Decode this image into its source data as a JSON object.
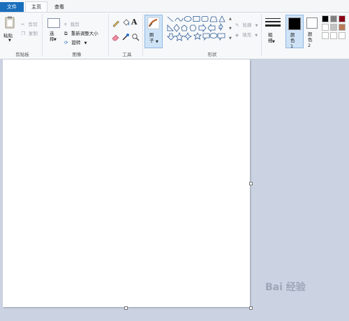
{
  "tabs": {
    "file": "文件",
    "home": "主页",
    "view": "查看"
  },
  "clipboard": {
    "paste": "粘贴",
    "cut": "剪切",
    "copy": "复制",
    "label": "剪贴板"
  },
  "image": {
    "select": "选择",
    "crop": "裁剪",
    "resize": "重新调整大小",
    "rotate": "旋转",
    "label": "图像"
  },
  "tools": {
    "text_glyph": "A",
    "label": "工具"
  },
  "brush": {
    "label": "刷子"
  },
  "shapes": {
    "outline": "轮廓",
    "fill": "填充",
    "label": "形状"
  },
  "size": {
    "label": "粗细"
  },
  "colors": {
    "color1_label": "颜色 1",
    "color2_label": "颜色 2",
    "color1": "#000000",
    "color2": "#ffffff",
    "palette": [
      "#000000",
      "#7f7f7f",
      "#880015",
      "#ffffff",
      "#c3c3c3",
      "#b97a57"
    ]
  },
  "watermark": "Bai 经验",
  "accent": "#1a6fbd"
}
